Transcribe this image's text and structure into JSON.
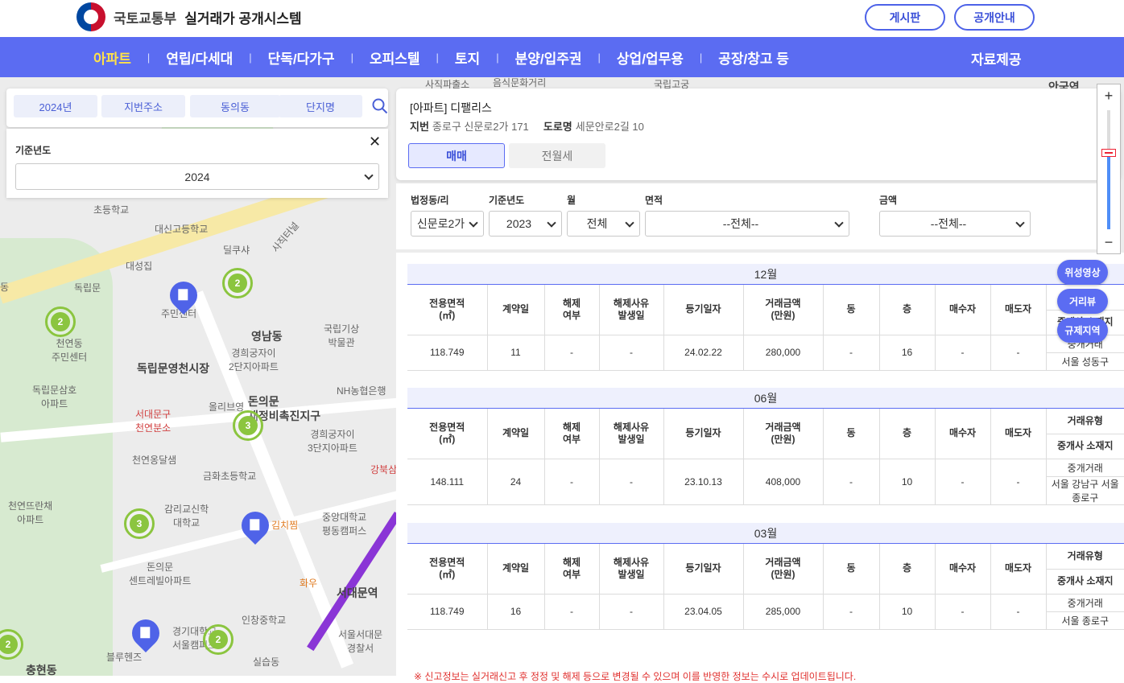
{
  "header": {
    "ministry": "국토교통부",
    "system": "실거래가 공개시스템",
    "board_btn": "게시판",
    "info_btn": "공개안내"
  },
  "nav": {
    "items": [
      "아파트",
      "연립/다세대",
      "단독/다가구",
      "오피스텔",
      "토지",
      "분양/입주권",
      "상업/업무용",
      "공장/창고 등"
    ],
    "active": "아파트",
    "data": "자료제공"
  },
  "search": {
    "chips": [
      "2024년",
      "지번주소",
      "동의동",
      "단지명"
    ]
  },
  "year_panel": {
    "title": "기준년도",
    "value": "2024"
  },
  "detail": {
    "title": "[아파트] 디팰리스",
    "jibun_label": "지번",
    "jibun": "종로구 신문로2가 171",
    "road_label": "도로명",
    "road": "세문안로2길 10",
    "tab_sale": "매매",
    "tab_rent": "전월세"
  },
  "filters": {
    "dong_label": "법정동/리",
    "dong": "신문로2가",
    "year_label": "기준년도",
    "year": "2023",
    "month_label": "월",
    "month": "전체",
    "area_label": "면적",
    "area": "--전체--",
    "price_label": "금액",
    "price": "--전체--"
  },
  "table_headers": [
    "전용면적\n(㎡)",
    "계약일",
    "해제\n여부",
    "해제사유\n발생일",
    "등기일자",
    "거래금액\n(만원)",
    "동",
    "층",
    "매수자",
    "매도자"
  ],
  "extra_headers": [
    "거래유형",
    "중개사 소재지"
  ],
  "months": [
    {
      "month": "12월",
      "row": [
        "118.749",
        "11",
        "-",
        "-",
        "24.02.22",
        "280,000",
        "-",
        "16",
        "-",
        "-"
      ],
      "deal_type": "중개거래",
      "broker": "서울 성동구"
    },
    {
      "month": "06월",
      "row": [
        "148.111",
        "24",
        "-",
        "-",
        "23.10.13",
        "408,000",
        "-",
        "10",
        "-",
        "-"
      ],
      "deal_type": "중개거래",
      "broker": "서울 강남구 서울 종로구"
    },
    {
      "month": "03월",
      "row": [
        "118.749",
        "16",
        "-",
        "-",
        "23.04.05",
        "285,000",
        "-",
        "10",
        "-",
        "-"
      ],
      "deal_type": "중개거래",
      "broker": "서울 종로구"
    }
  ],
  "side_buttons": [
    "위성영상",
    "거리뷰",
    "규제지역"
  ],
  "zoom": {
    "plus": "+",
    "minus": "−"
  },
  "map_labels": {
    "l1": "독립문",
    "l2": "독립문영천시장",
    "l3": "돈의문\n재정비촉진지구",
    "l4": "대성집",
    "l5": "딜쿠샤",
    "l6": "대신고등학교",
    "l7": "사직터널",
    "l8": "천연동\n주민센터",
    "l9": "경희궁자이\n2단지아파트",
    "l10": "국립기상\n박물관",
    "l11": "NH농협은행",
    "l12": "서대문구\n천연분소",
    "l13": "올리브영",
    "l14": "경희궁자이\n3단지아파트",
    "l15": "천연옹달샘",
    "l16": "금화초등학교",
    "l17": "감리교신학\n대학교",
    "l18": "김치찜",
    "l19": "중앙대학교\n평동캠퍼스",
    "l20": "천연뜨란채\n아파트",
    "l21": "돈의문\n센트레빌아파트",
    "l22": "서대문역",
    "l23": "인창중학교",
    "l24": "서울서대문\n경찰서",
    "l25": "경기대학교\n서울캠퍼스",
    "l26": "블루헨즈",
    "l27": "충현동",
    "l28": "강북삼",
    "l29": "화우",
    "l30": "독립문삼호\n아파트",
    "l31": "초등학교",
    "l32": "주민센터",
    "l33": "실습동",
    "l34": "사직파출소",
    "l35": "음식문화거리",
    "l36": "국립고궁",
    "l37": "안국역",
    "l38": "영남동",
    "l39": "동"
  },
  "clusters": [
    "2",
    "2",
    "3",
    "3",
    "2",
    "2"
  ],
  "footer_note": "※ 신고정보는 실거래신고 후 정정 및 해제 등으로 변경될 수 있으며 이를 반영한 정보는 수시로 업데이트됩니다."
}
